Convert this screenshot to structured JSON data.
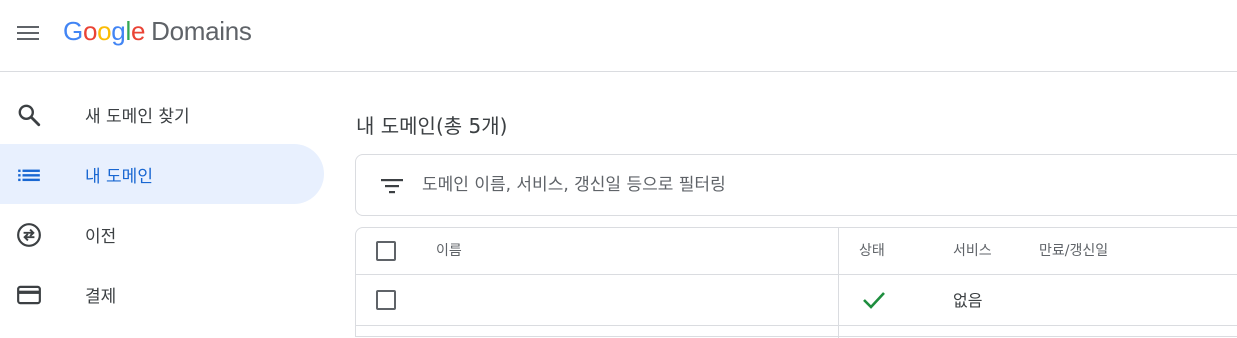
{
  "header": {
    "logo_google": [
      "G",
      "o",
      "o",
      "g",
      "l",
      "e"
    ],
    "logo_product": "Domains",
    "menu_icon": "hamburger-menu-icon"
  },
  "sidebar": {
    "items": [
      {
        "label": "새 도메인 찾기",
        "icon": "search-icon",
        "active": false
      },
      {
        "label": "내 도메인",
        "icon": "list-icon",
        "active": true
      },
      {
        "label": "이전",
        "icon": "transfer-icon",
        "active": false
      },
      {
        "label": "결제",
        "icon": "credit-card-icon",
        "active": false
      }
    ]
  },
  "main": {
    "title": "내 도메인(총 5개)",
    "filter": {
      "icon": "filter-icon",
      "placeholder": "도메인 이름, 서비스, 갱신일 등으로 필터링"
    },
    "table": {
      "columns": [
        "이름",
        "상태",
        "서비스",
        "만료/갱신일"
      ],
      "rows": [
        {
          "name": "",
          "status_icon": "check-icon",
          "service": "없음",
          "expiry": ""
        }
      ]
    }
  },
  "colors": {
    "accent": "#1967d2",
    "active_bg": "#e8f0fe",
    "status_ok": "#1e8e3e",
    "border": "#dadce0"
  }
}
